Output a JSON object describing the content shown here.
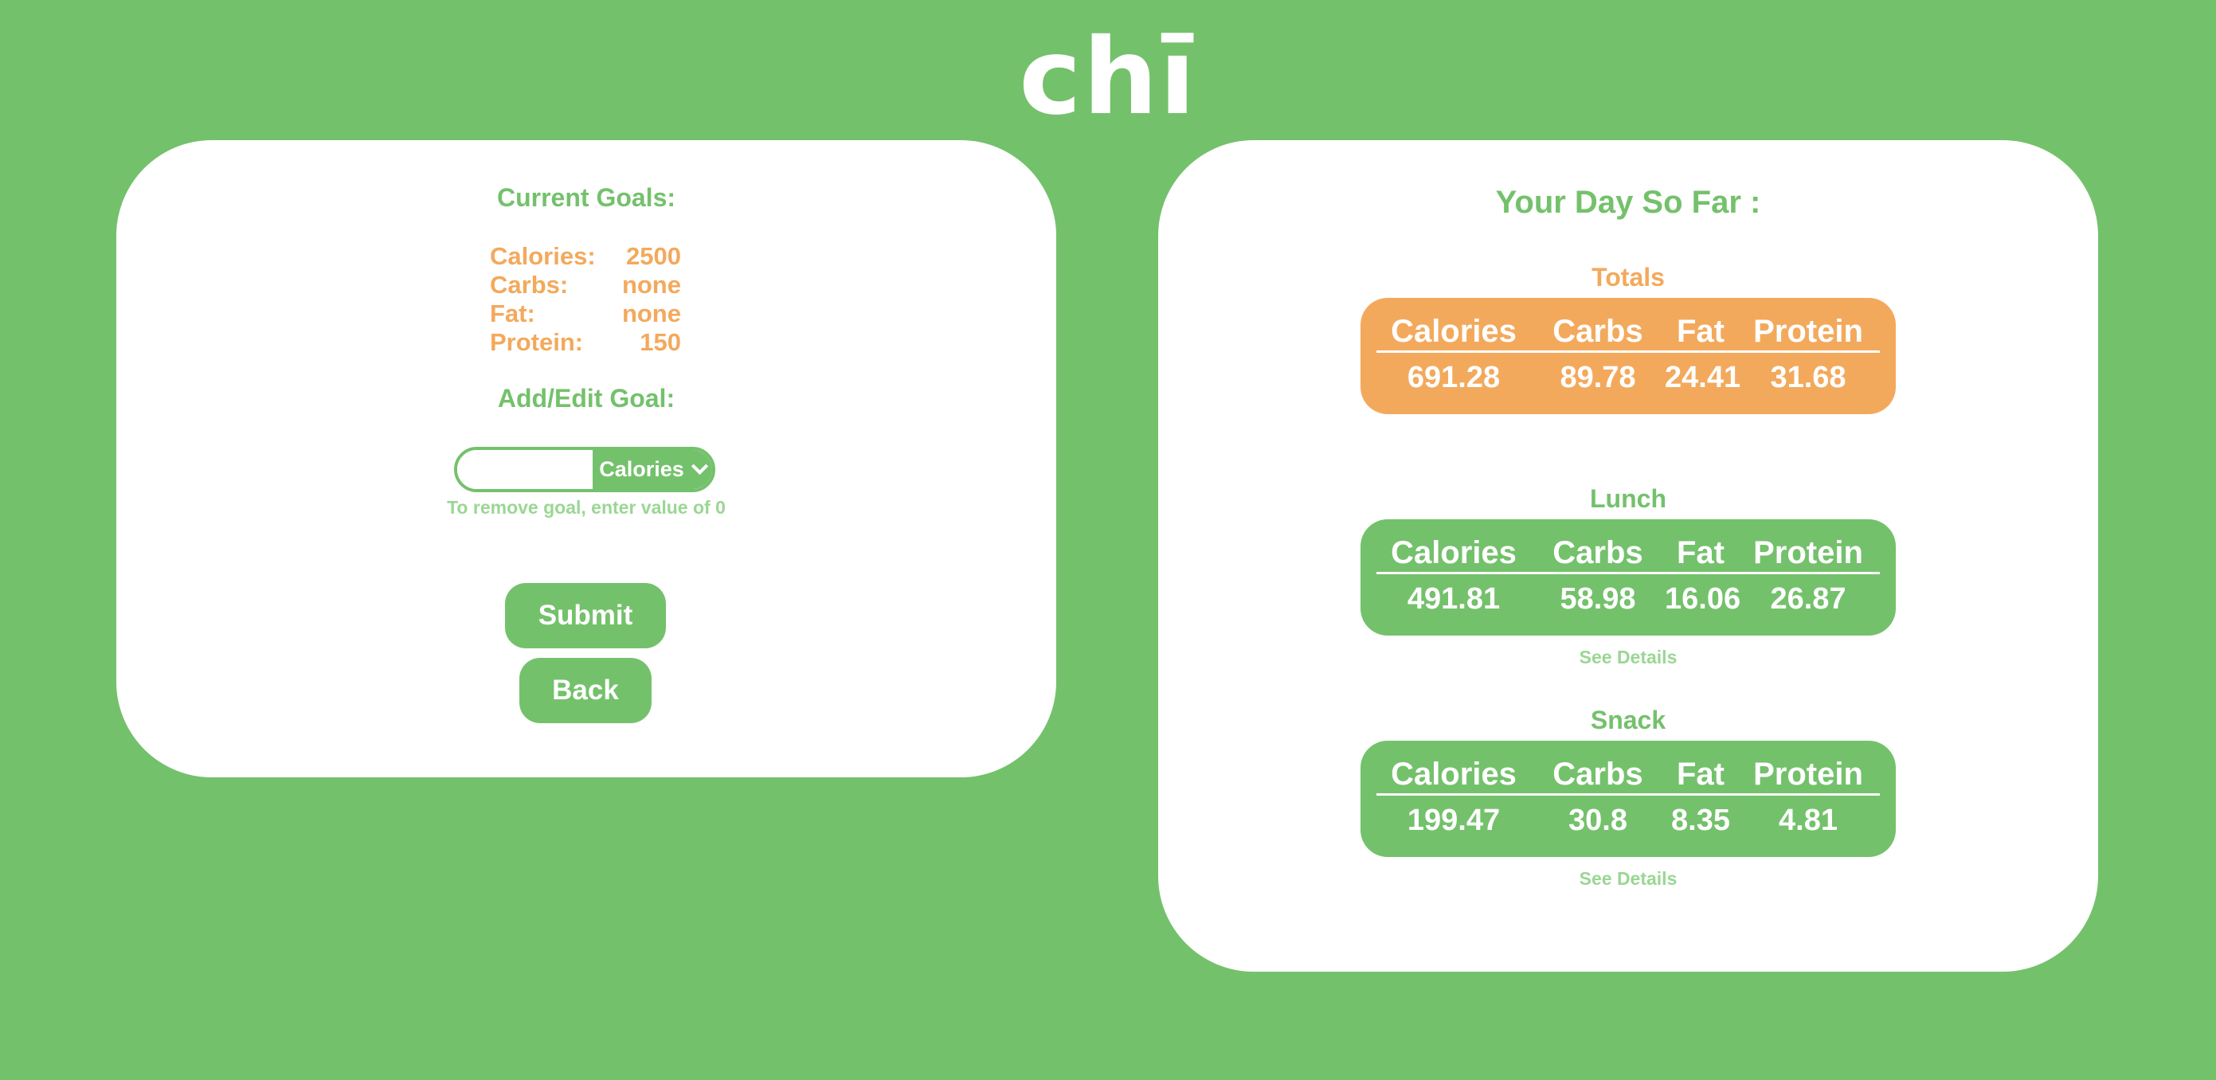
{
  "logo": "chī",
  "colors": {
    "background": "#74c16c",
    "accent_orange": "#f3a95c",
    "hint_green": "#9bd694",
    "panel": "#ffffff"
  },
  "goals_panel": {
    "current_goals_title": "Current Goals:",
    "goals": [
      {
        "label": "Calories:",
        "value": "2500"
      },
      {
        "label": "Carbs:",
        "value": "none"
      },
      {
        "label": "Fat:",
        "value": "none"
      },
      {
        "label": "Protein:",
        "value": "150"
      }
    ],
    "add_edit_title": "Add/Edit Goal:",
    "goal_input": {
      "value": "",
      "placeholder": ""
    },
    "goal_select": {
      "selected": "Calories",
      "icon": "chevron-down-icon"
    },
    "hint": "To remove goal, enter value of 0",
    "submit_label": "Submit",
    "back_label": "Back"
  },
  "day_panel": {
    "title": "Your Day So Far :",
    "column_headers": [
      "Calories",
      "Carbs",
      "Fat",
      "Protein"
    ],
    "totals": {
      "label": "Totals",
      "values": [
        "691.28",
        "89.78",
        "24.41",
        "31.68"
      ]
    },
    "meals": [
      {
        "label": "Lunch",
        "values": [
          "491.81",
          "58.98",
          "16.06",
          "26.87"
        ],
        "details_label": "See Details"
      },
      {
        "label": "Snack",
        "values": [
          "199.47",
          "30.8",
          "8.35",
          "4.81"
        ],
        "details_label": "See Details"
      }
    ]
  }
}
